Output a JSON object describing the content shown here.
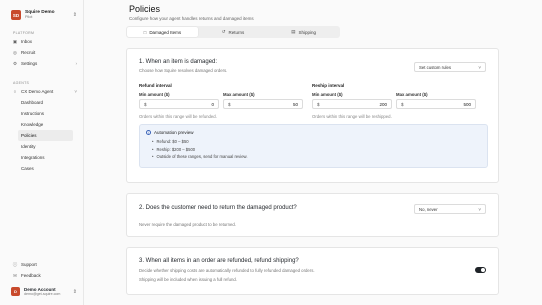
{
  "workspace": {
    "logo_initials": "SD",
    "name": "Squire Demo",
    "plan": "Pilot"
  },
  "sidebar": {
    "platform_label": "PLATFORM",
    "platform_items": [
      {
        "label": "Inbox",
        "icon": "inbox-icon"
      },
      {
        "label": "Recruit",
        "icon": "recruit-icon"
      },
      {
        "label": "Settings",
        "icon": "gear-icon"
      }
    ],
    "agents_label": "AGENTS",
    "agent": {
      "label": "CX Demo Agent",
      "icon": "agent-icon"
    },
    "agent_items": [
      {
        "label": "Dashboard"
      },
      {
        "label": "Instructions"
      },
      {
        "label": "Knowledge"
      },
      {
        "label": "Policies",
        "active": true
      },
      {
        "label": "Identity"
      },
      {
        "label": "Integrations"
      },
      {
        "label": "Cases"
      }
    ],
    "support_label": "Support",
    "feedback_label": "Feedback",
    "account": {
      "initials": "D",
      "name": "Demo Account",
      "email": "demo@get-squire.com"
    }
  },
  "page": {
    "title": "Policies",
    "subtitle": "Configure how your agent handles returns and damaged items",
    "tabs": [
      {
        "label": "Damaged Items",
        "icon": "package-icon",
        "active": true
      },
      {
        "label": "Returns",
        "icon": "return-icon",
        "active": false
      },
      {
        "label": "Shipping",
        "icon": "truck-icon",
        "active": false
      }
    ]
  },
  "damaged_card": {
    "heading": "1. When an item is damaged:",
    "description": "Choose how Squire resolves damaged orders.",
    "select_value": "Set custom rules",
    "refund": {
      "title": "Refund interval",
      "min_label": "Min amount ($)",
      "min_currency": "$",
      "min_value": "0",
      "max_label": "Max amount ($)",
      "max_currency": "$",
      "max_value": "50",
      "note": "Orders within this range will be refunded."
    },
    "reship": {
      "title": "Reship interval",
      "min_label": "Min amount ($)",
      "min_currency": "$",
      "min_value": "200",
      "max_label": "Max amount ($)",
      "max_currency": "$",
      "max_value": "500",
      "note": "Orders within this range will be reshipped."
    },
    "preview": {
      "title": "Automation preview",
      "items": [
        "Refund: $0 – $50",
        "Reship: $200 – $500",
        "Outside of these ranges, send for manual review."
      ]
    }
  },
  "return_card": {
    "heading": "2. Does the customer need to return the damaged product?",
    "description": "Never require the damaged product to be returned.",
    "select_value": "No, never"
  },
  "shipping_card": {
    "heading": "3. When all items in an order are refunded, refund shipping?",
    "description": "Decide whether shipping costs are automatically refunded to fully refunded damaged orders.",
    "description2": "Shipping will be included when issuing a full refund.",
    "toggle_on": true
  }
}
